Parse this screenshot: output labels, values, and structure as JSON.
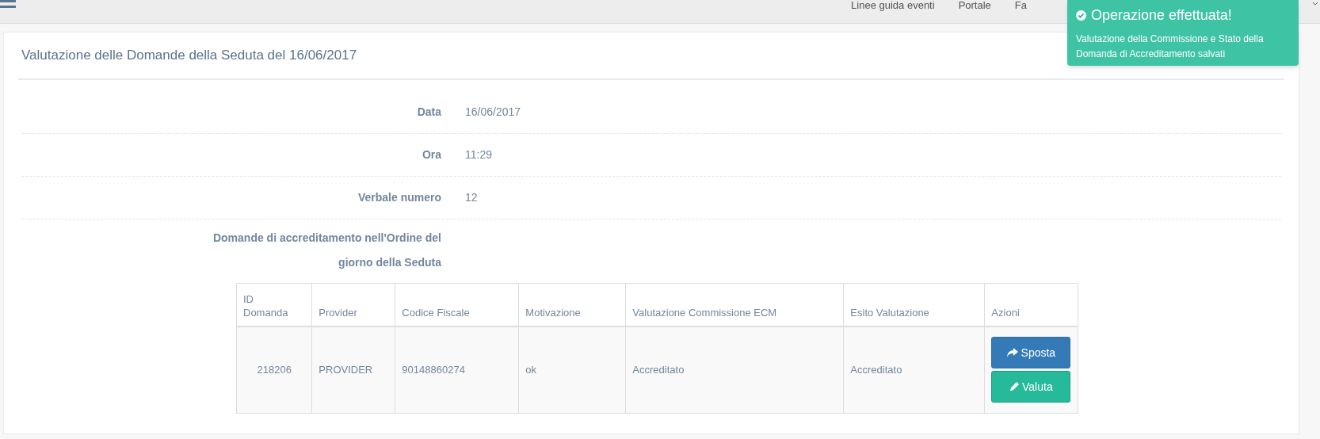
{
  "navbar": {
    "links": [
      "Linee guida eventi",
      "Portale",
      "Fa"
    ]
  },
  "page": {
    "title": "Valutazione delle Domande della Seduta del 16/06/2017"
  },
  "fields": [
    {
      "label": "Data",
      "value": "16/06/2017"
    },
    {
      "label": "Ora",
      "value": "11:29"
    },
    {
      "label": "Verbale numero",
      "value": "12"
    },
    {
      "label": "Domande di accreditamento nell'Ordine del giorno della Seduta"
    }
  ],
  "table": {
    "columns": [
      "ID Domanda",
      "Provider",
      "Codice Fiscale",
      "Motivazione",
      "Valutazione Commissione ECM",
      "Esito Valutazione",
      "Azioni"
    ],
    "rows": [
      {
        "cells": [
          "218206",
          "PROVIDER",
          "90148860274",
          "ok",
          "Accreditato",
          "Accreditato"
        ],
        "actions": [
          {
            "label": "Sposta",
            "kind": "primary"
          },
          {
            "label": "Valuta",
            "kind": "success"
          }
        ]
      }
    ]
  },
  "toast": {
    "title": "Operazione effettuata!",
    "message": "Valutazione della Commissione e Stato della Domanda di Accreditamento salvati"
  }
}
